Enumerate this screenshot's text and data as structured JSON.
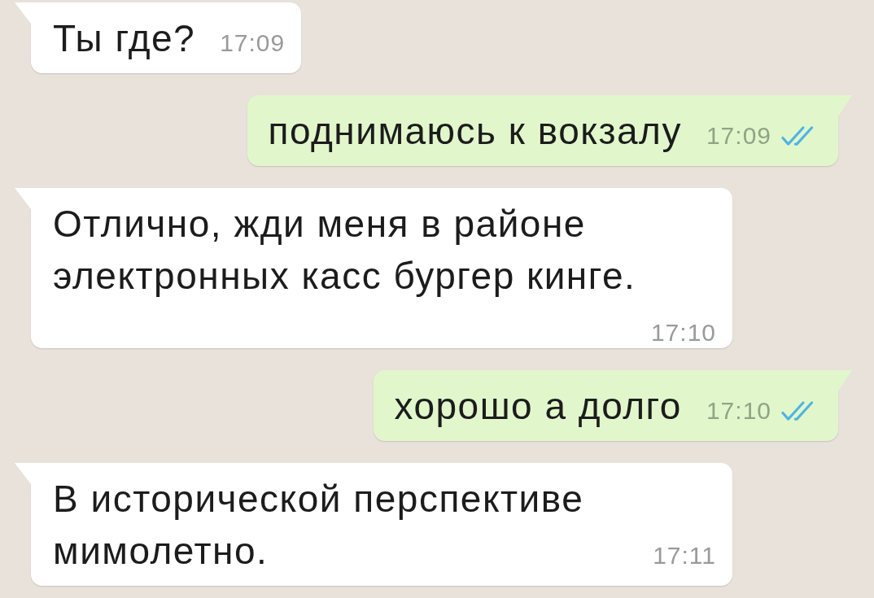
{
  "messages": [
    {
      "kind": "incoming",
      "text": "Ты где?",
      "time": "17:09"
    },
    {
      "kind": "outgoing",
      "text": "поднимаюсь к вокзалу",
      "time": "17:09",
      "read": true
    },
    {
      "kind": "incoming",
      "text": "Отлично, жди меня в районе электронных касс бургер кинге.",
      "time": "17:10"
    },
    {
      "kind": "outgoing",
      "text": "хорошо а долго",
      "time": "17:10",
      "read": true
    },
    {
      "kind": "incoming",
      "text": "В исторической перспективе мимолетно.",
      "time": "17:11"
    }
  ]
}
